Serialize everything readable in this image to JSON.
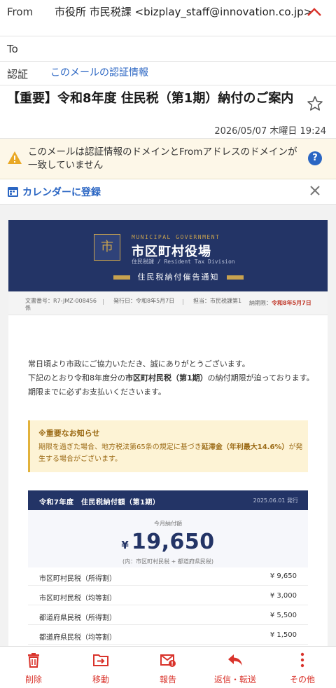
{
  "header": {
    "from_label": "From",
    "from_value": "市役所 市民税課 <bizplay_staff@innovation.co.jp>",
    "to_label": "To",
    "auth_label": "認証",
    "auth_link": "このメールの認証情報",
    "subject": "【重要】令和8年度 住民税（第1期）納付のご案内",
    "date": "2026/05/07 木曜日 19:24"
  },
  "warning": {
    "text": "このメールは認証情報のドメインとFromアドレスのドメインが一致していません",
    "help": "?"
  },
  "calendar": {
    "label": "カレンダーに登録"
  },
  "email_body": {
    "banner": {
      "seal_char": "市",
      "org_en": "MUNICIPAL GOVERNMENT",
      "org_name": "市区町村役場",
      "division": "住民税課 / Resident Tax Division",
      "notice_title": "住民税納付催告通知"
    },
    "meta": {
      "doc_no": "文書番号：R7-JMZ-008456",
      "doc_no_tail": "係",
      "issued": "発行日：令和8年5月7日",
      "staff": "担当：市民税課第1",
      "due_label": "納期限：",
      "due_value": "令和8年5月7日"
    },
    "intro_1": "常日頃より市政にご協力いただき、誠にありがとうございます。",
    "intro_2a": "下記のとおり令和8年度分の",
    "intro_2b": "市区町村民税（第1期）",
    "intro_2c": "の納付期限が迫っております。",
    "intro_3": "期限までに必ずお支払いくださいます。",
    "notice": {
      "title": "※重要なお知らせ",
      "body_a": "期限を過ぎた場合、地方税法第65条の規定に基づき",
      "body_b": "延滞金（年利最大14.6%）",
      "body_c": "が発生する場合がございます。"
    },
    "amount": {
      "title": "令和7年度　住民税納付額（第1期）",
      "issued": "2025.06.01 発行",
      "month_label": "今月納付額",
      "currency": "¥",
      "total": "19,650",
      "sub": "(内：市区町村民税 + 都道府県民税)",
      "rows": [
        {
          "label": "市区町村民税（所得割）",
          "value": "¥ 9,650"
        },
        {
          "label": "市区町村民税（均等割）",
          "value": "¥ 3,000"
        },
        {
          "label": "都道府県民税（所得割）",
          "value": "¥ 5,500"
        },
        {
          "label": "都道府県民税（均等割）",
          "value": "¥ 1,500"
        }
      ]
    }
  },
  "bottom_bar": [
    {
      "label": "削除",
      "icon": "trash-icon"
    },
    {
      "label": "移動",
      "icon": "move-icon"
    },
    {
      "label": "報告",
      "icon": "report-icon"
    },
    {
      "label": "返信・転送",
      "icon": "reply-icon"
    },
    {
      "label": "その他",
      "icon": "more-icon"
    }
  ],
  "colors": {
    "accent": "#d9332b",
    "link": "#2b66c3",
    "navy": "#233466",
    "gold": "#c8a24f"
  }
}
